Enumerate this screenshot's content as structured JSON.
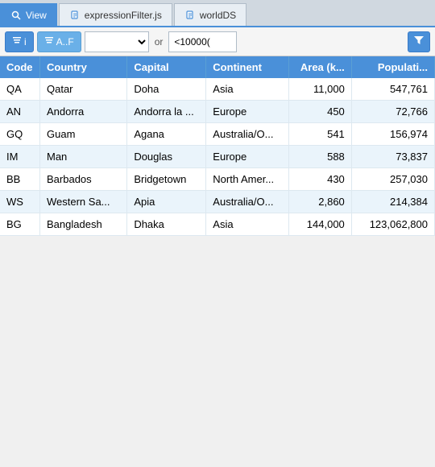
{
  "tabs": [
    {
      "id": "view",
      "label": "View",
      "icon": "search",
      "active": true
    },
    {
      "id": "expressionFilter",
      "label": "expressionFilter.js",
      "icon": "file",
      "active": false
    },
    {
      "id": "worldDS",
      "label": "worldDS",
      "icon": "file",
      "active": false
    }
  ],
  "toolbar": {
    "filter1_label": "i",
    "filter2_label": "A..F",
    "dropdown_value": "",
    "or_label": "or",
    "condition_value": "<10000(",
    "funnel_icon": "funnel"
  },
  "table": {
    "columns": [
      {
        "id": "code",
        "label": "Code",
        "align": "left"
      },
      {
        "id": "country",
        "label": "Country",
        "align": "left"
      },
      {
        "id": "capital",
        "label": "Capital",
        "align": "left"
      },
      {
        "id": "continent",
        "label": "Continent",
        "align": "left"
      },
      {
        "id": "area",
        "label": "Area (k...",
        "align": "right"
      },
      {
        "id": "population",
        "label": "Populati...",
        "align": "right"
      }
    ],
    "rows": [
      {
        "code": "QA",
        "country": "Qatar",
        "capital": "Doha",
        "continent": "Asia",
        "area": "11,000",
        "population": "547,761"
      },
      {
        "code": "AN",
        "country": "Andorra",
        "capital": "Andorra la ...",
        "continent": "Europe",
        "area": "450",
        "population": "72,766"
      },
      {
        "code": "GQ",
        "country": "Guam",
        "capital": "Agana",
        "continent": "Australia/O...",
        "area": "541",
        "population": "156,974"
      },
      {
        "code": "IM",
        "country": "Man",
        "capital": "Douglas",
        "continent": "Europe",
        "area": "588",
        "population": "73,837"
      },
      {
        "code": "BB",
        "country": "Barbados",
        "capital": "Bridgetown",
        "continent": "North Amer...",
        "area": "430",
        "population": "257,030"
      },
      {
        "code": "WS",
        "country": "Western Sa...",
        "capital": "Apia",
        "continent": "Australia/O...",
        "area": "2,860",
        "population": "214,384"
      },
      {
        "code": "BG",
        "country": "Bangladesh",
        "capital": "Dhaka",
        "continent": "Asia",
        "area": "144,000",
        "population": "123,062,800"
      }
    ]
  }
}
